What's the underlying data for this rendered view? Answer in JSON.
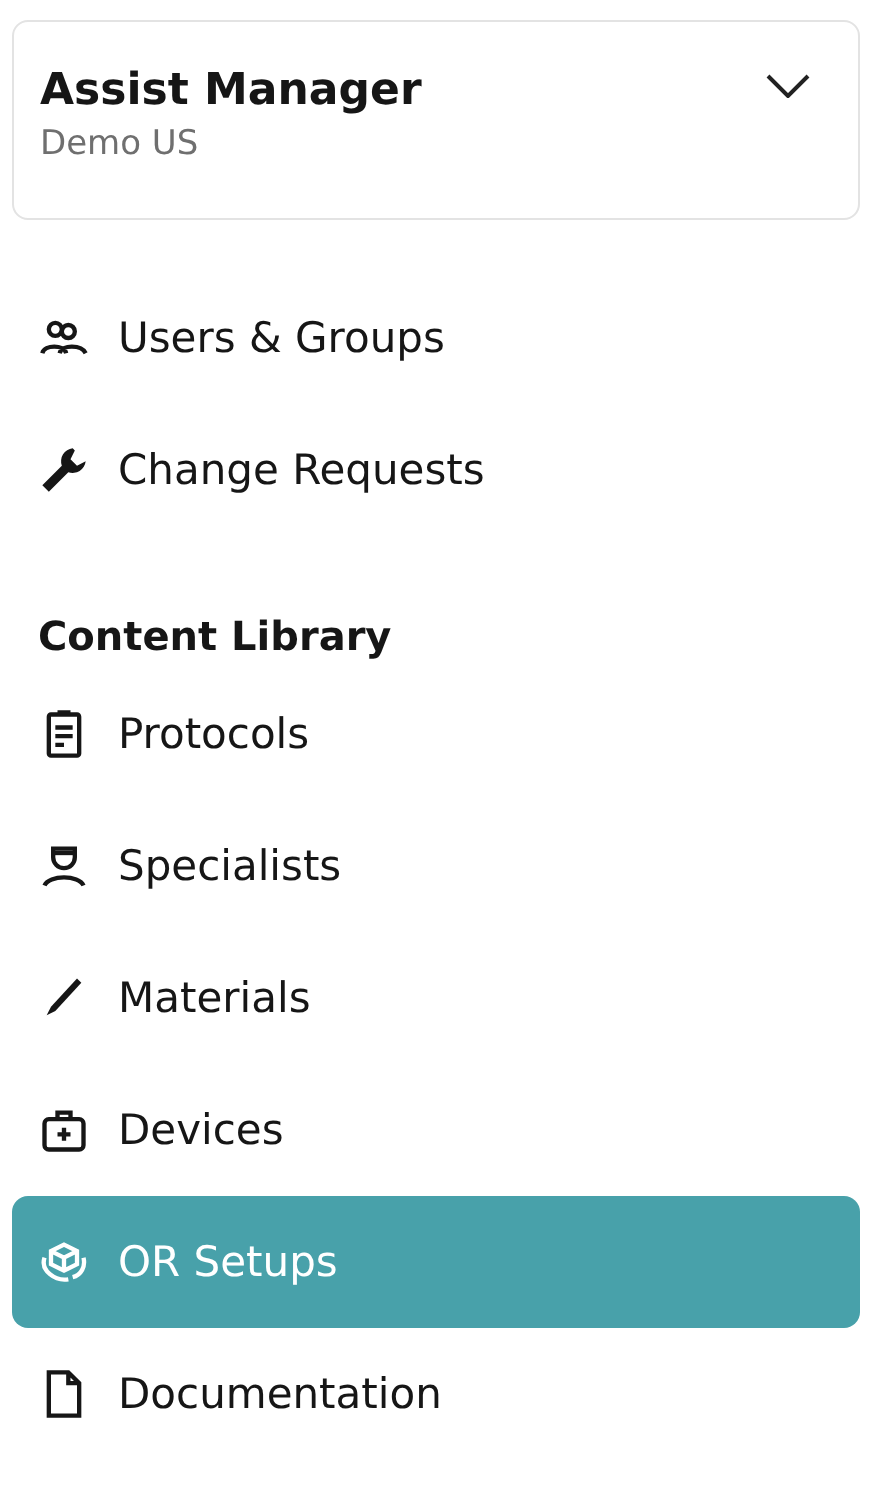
{
  "account": {
    "title": "Assist Manager",
    "subtitle": "Demo US"
  },
  "top_items": [
    {
      "label": "Users & Groups",
      "kind": "users",
      "selected": false
    },
    {
      "label": "Change Requests",
      "kind": "wrench",
      "selected": false
    }
  ],
  "section": {
    "heading": "Content Library",
    "items": [
      {
        "label": "Protocols",
        "kind": "clipboard",
        "selected": false
      },
      {
        "label": "Specialists",
        "kind": "specialist",
        "selected": false
      },
      {
        "label": "Materials",
        "kind": "scalpel",
        "selected": false
      },
      {
        "label": "Devices",
        "kind": "kit",
        "selected": false
      },
      {
        "label": "OR Setups",
        "kind": "cube",
        "selected": true
      },
      {
        "label": "Documentation",
        "kind": "file",
        "selected": false
      }
    ]
  }
}
